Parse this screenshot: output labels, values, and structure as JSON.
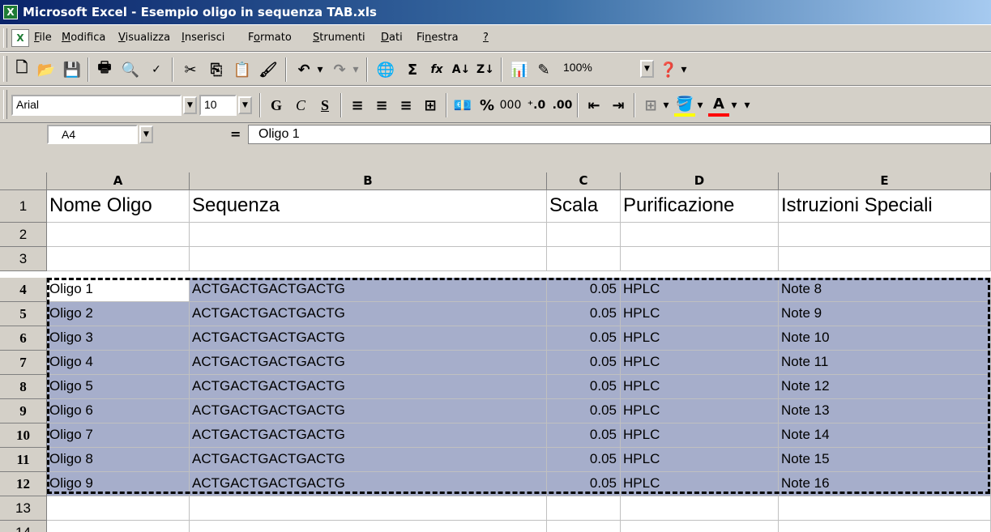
{
  "window": {
    "title": "Microsoft Excel - Esempio oligo in sequenza TAB.xls"
  },
  "menu": [
    {
      "pre": "",
      "key": "F",
      "post": "ile"
    },
    {
      "pre": "",
      "key": "M",
      "post": "odifica"
    },
    {
      "pre": "",
      "key": "V",
      "post": "isualizza"
    },
    {
      "pre": "",
      "key": "I",
      "post": "nserisci"
    },
    {
      "pre": "F",
      "key": "o",
      "post": "rmato"
    },
    {
      "pre": "",
      "key": "S",
      "post": "trumenti"
    },
    {
      "pre": "",
      "key": "D",
      "post": "ati"
    },
    {
      "pre": "Fi",
      "key": "n",
      "post": "estra"
    },
    {
      "pre": "",
      "key": "?",
      "post": ""
    }
  ],
  "toolbar": {
    "zoom": "100%",
    "font": "Arial",
    "font_size": "10",
    "bold": "G",
    "italic": "C",
    "underline": "S",
    "percent": "%",
    "thousands": "000",
    "inc_decimal": "⁺⁰.⁰⁰",
    "dec_decimal": ".⁰⁰",
    "sum": "Σ",
    "function": "fx"
  },
  "formula_bar": {
    "name_box": "A4",
    "equals": "=",
    "value": "Oligo 1"
  },
  "columns": [
    "A",
    "B",
    "C",
    "D",
    "E"
  ],
  "rows": [
    {
      "num": "1",
      "cells": [
        "Nome Oligo",
        "Sequenza",
        "Scala",
        "Purificazione",
        "Istruzioni Speciali"
      ]
    },
    {
      "num": "2",
      "cells": [
        "",
        "",
        "",
        "",
        ""
      ]
    },
    {
      "num": "3",
      "cells": [
        "",
        "",
        "",
        "",
        ""
      ]
    },
    {
      "num": "4",
      "cells": [
        "Oligo 1",
        "ACTGACTGACTGACTG",
        "0.05",
        "HPLC",
        "Note 8"
      ]
    },
    {
      "num": "5",
      "cells": [
        "Oligo 2",
        "ACTGACTGACTGACTG",
        "0.05",
        "HPLC",
        "Note 9"
      ]
    },
    {
      "num": "6",
      "cells": [
        "Oligo 3",
        "ACTGACTGACTGACTG",
        "0.05",
        "HPLC",
        "Note 10"
      ]
    },
    {
      "num": "7",
      "cells": [
        "Oligo 4",
        "ACTGACTGACTGACTG",
        "0.05",
        "HPLC",
        "Note 11"
      ]
    },
    {
      "num": "8",
      "cells": [
        "Oligo 5",
        "ACTGACTGACTGACTG",
        "0.05",
        "HPLC",
        "Note 12"
      ]
    },
    {
      "num": "9",
      "cells": [
        "Oligo 6",
        "ACTGACTGACTGACTG",
        "0.05",
        "HPLC",
        "Note 13"
      ]
    },
    {
      "num": "10",
      "cells": [
        "Oligo 7",
        "ACTGACTGACTGACTG",
        "0.05",
        "HPLC",
        "Note 14"
      ]
    },
    {
      "num": "11",
      "cells": [
        "Oligo 8",
        "ACTGACTGACTGACTG",
        "0.05",
        "HPLC",
        "Note 15"
      ]
    },
    {
      "num": "12",
      "cells": [
        "Oligo 9",
        "ACTGACTGACTGACTG",
        "0.05",
        "HPLC",
        "Note 16"
      ]
    },
    {
      "num": "13",
      "cells": [
        "",
        "",
        "",
        "",
        ""
      ]
    },
    {
      "num": "14",
      "cells": [
        "",
        "",
        "",
        "",
        ""
      ]
    }
  ],
  "colors": {
    "selection": "#a6aecb",
    "titlebar_start": "#0a246a",
    "titlebar_end": "#a6caf0",
    "font_color": "#ff0000",
    "fill_color": "#ffff00"
  }
}
